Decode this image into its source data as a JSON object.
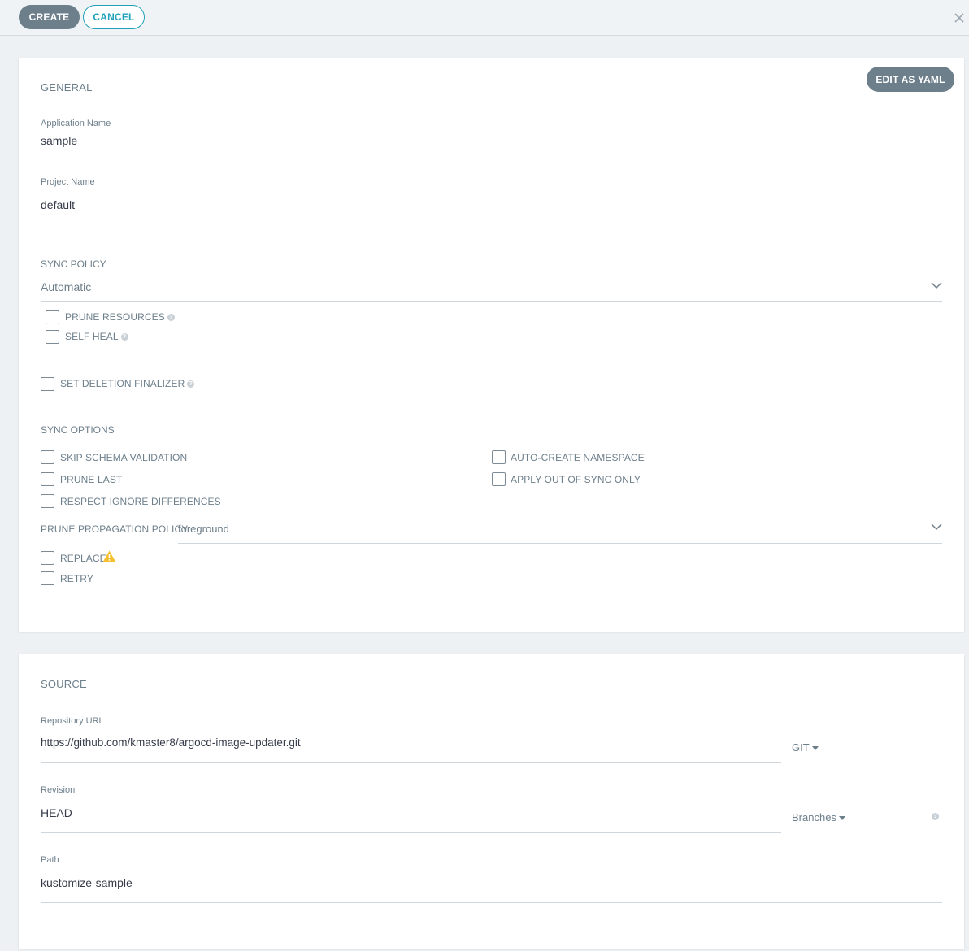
{
  "toolbar": {
    "create_label": "CREATE",
    "cancel_label": "CANCEL",
    "close_icon": "close-icon"
  },
  "general": {
    "title": "GENERAL",
    "edit_yaml_label": "EDIT AS YAML",
    "app_name_label": "Application Name",
    "app_name_value": "sample",
    "project_label": "Project Name",
    "project_value": "default",
    "sync_policy_label": "SYNC POLICY",
    "sync_policy_value": "Automatic",
    "prune_resources_label": "PRUNE RESOURCES",
    "self_heal_label": "SELF HEAL",
    "deletion_finalizer_label": "SET DELETION FINALIZER",
    "sync_options_title": "SYNC OPTIONS",
    "sync_options": {
      "skip_schema": "SKIP SCHEMA VALIDATION",
      "prune_last": "PRUNE LAST",
      "respect_ignore": "RESPECT IGNORE DIFFERENCES",
      "auto_create_ns": "AUTO-CREATE NAMESPACE",
      "apply_out_of_sync": "APPLY OUT OF SYNC ONLY"
    },
    "prune_propagation_label": "PRUNE PROPAGATION POLICY:",
    "prune_propagation_value": "foreground",
    "replace_label": "REPLACE",
    "retry_label": "RETRY",
    "help_glyph": "?",
    "colors": {
      "warning": "#f4c030",
      "accent": "#1ea0b9",
      "button_dark": "#6d7f8b"
    }
  },
  "source": {
    "title": "SOURCE",
    "repo_url_label": "Repository URL",
    "repo_url_value": "https://github.com/kmaster8/argocd-image-updater.git",
    "repo_type": "GIT",
    "revision_label": "Revision",
    "revision_value": "HEAD",
    "revision_type": "Branches",
    "path_label": "Path",
    "path_value": "kustomize-sample",
    "help_glyph": "?"
  }
}
